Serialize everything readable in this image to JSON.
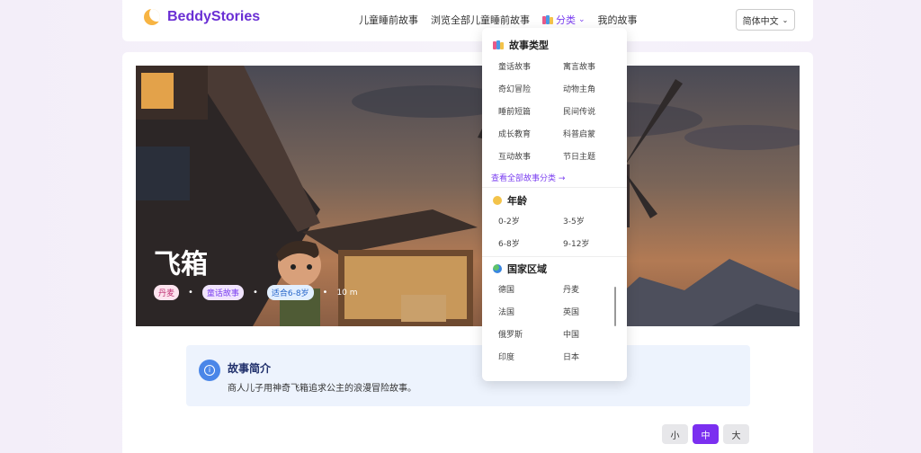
{
  "header": {
    "brand": "BeddyStories",
    "nav": [
      "儿童睡前故事",
      "浏览全部儿童睡前故事",
      "分类",
      "我的故事"
    ],
    "language": "简体中文"
  },
  "hero": {
    "title": "飞箱",
    "tags": [
      "丹麦",
      "童话故事",
      "适合6-8岁"
    ],
    "duration": "10 m"
  },
  "summary": {
    "title": "故事简介",
    "text": "商人儿子用神奇飞箱追求公主的浪漫冒险故事。"
  },
  "font_sizes": [
    "小",
    "中",
    "大"
  ],
  "dropdown": {
    "story_types": {
      "heading": "故事类型",
      "items": [
        "童话故事",
        "寓言故事",
        "奇幻冒险",
        "动物主角",
        "睡前短篇",
        "民间传说",
        "成长教育",
        "科普启蒙",
        "互动故事",
        "节日主题"
      ],
      "more": "查看全部故事分类 →"
    },
    "age": {
      "heading": "年龄",
      "items": [
        "0-2岁",
        "3-5岁",
        "6-8岁",
        "9-12岁"
      ]
    },
    "region": {
      "heading": "国家区域",
      "items": [
        "德国",
        "丹麦",
        "法国",
        "英国",
        "俄罗斯",
        "中国",
        "印度",
        "日本"
      ]
    }
  },
  "colors": {
    "accent": "#7b2ff0",
    "brand": "#6a2fd4"
  }
}
